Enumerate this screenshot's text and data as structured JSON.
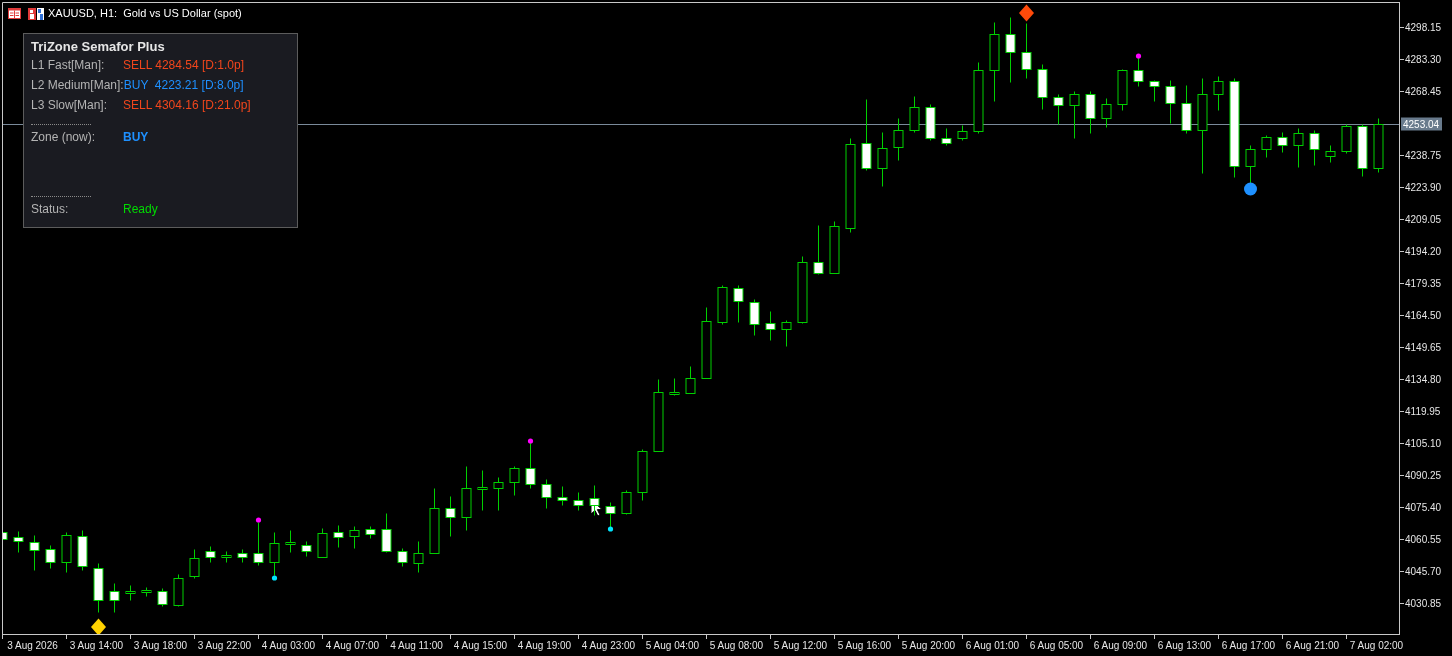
{
  "chart_window": {
    "title": "XAUUSD, H1:  Gold vs US Dollar (spot)"
  },
  "indicator_panel": {
    "title": "TriZone Semafor Plus",
    "levels": [
      {
        "label": "L1 Fast[Man]:",
        "kind": "sell",
        "value": "SELL 4284.54 [D:1.0p]"
      },
      {
        "label": "L2 Medium[Man]:",
        "kind": "buy",
        "value": "BUY  4223.21 [D:8.0p]"
      },
      {
        "label": "L3 Slow[Man]:",
        "kind": "sell",
        "value": "SELL 4304.16 [D:21.0p]"
      }
    ],
    "zone": {
      "label": "Zone (now):",
      "kind": "buy",
      "value": "BUY"
    },
    "status": {
      "label": "Status:",
      "kind": "ready",
      "value": "Ready"
    }
  },
  "chart": {
    "chart_data": {
      "type": "candlestick",
      "categories": [
        null,
        null,
        "3 Aug 2026",
        null,
        null,
        null,
        "3 Aug 14:00",
        null,
        null,
        null,
        "3 Aug 18:00",
        null,
        null,
        null,
        "3 Aug 22:00",
        null,
        null,
        null,
        "4 Aug 03:00",
        null,
        null,
        null,
        "4 Aug 07:00",
        null,
        null,
        null,
        "4 Aug 11:00",
        null,
        null,
        null,
        "4 Aug 15:00",
        null,
        null,
        null,
        "4 Aug 19:00",
        null,
        null,
        null,
        "4 Aug 23:00",
        null,
        null,
        null,
        "5 Aug 04:00",
        null,
        null,
        null,
        "5 Aug 08:00",
        null,
        null,
        null,
        "5 Aug 12:00",
        null,
        null,
        null,
        "5 Aug 16:00",
        null,
        null,
        null,
        "5 Aug 20:00",
        null,
        null,
        null,
        "6 Aug 01:00",
        null,
        null,
        null,
        "6 Aug 05:00",
        null,
        null,
        null,
        "6 Aug 09:00",
        null,
        null,
        null,
        "6 Aug 13:00",
        null,
        null,
        null,
        "6 Aug 17:00",
        null,
        null,
        null,
        "6 Aug 21:00",
        null,
        null,
        null,
        "7 Aug 02:00"
      ],
      "ohlc": [
        [
          4063.8,
          4064.73,
          4059.62,
          4060.55
        ],
        [
          4061.48,
          4064.26,
          4054.52,
          4059.62
        ],
        [
          4059.16,
          4062.41,
          4046.17,
          4055.45
        ],
        [
          4055.91,
          4057.77,
          4047.09,
          4049.88
        ],
        [
          4049.88,
          4063.8,
          4045.24,
          4062.41
        ],
        [
          4061.94,
          4064.73,
          4046.17,
          4048.02
        ],
        [
          4047.09,
          4049.41,
          4026.67,
          4032.24
        ],
        [
          4036.42,
          4040.13,
          4026.67,
          4032.24
        ],
        [
          4035.49,
          4039.2,
          4032.24,
          4036.42
        ],
        [
          4035.96,
          4038.28,
          4034.1,
          4036.88
        ],
        [
          4036.42,
          4037.81,
          4029.46,
          4030.39
        ],
        [
          4029.92,
          4044.31,
          4029.46,
          4042.45
        ],
        [
          4043.38,
          4055.91,
          4042.45,
          4051.73
        ],
        [
          4054.98,
          4057.3,
          4049.88,
          4052.2
        ],
        [
          4052.2,
          4054.98,
          4049.88,
          4053.13
        ],
        [
          4054.05,
          4055.91,
          4049.88,
          4052.2
        ],
        [
          4054.05,
          4068.44,
          4048.49,
          4049.88
        ],
        [
          4049.88,
          4063.8,
          4043.84,
          4058.69
        ],
        [
          4058.23,
          4064.73,
          4054.52,
          4059.16
        ],
        [
          4057.77,
          4059.62,
          4052.66,
          4054.98
        ],
        [
          4052.2,
          4065.66,
          4052.2,
          4063.34
        ],
        [
          4063.8,
          4067.05,
          4056.84,
          4061.48
        ],
        [
          4061.94,
          4066.58,
          4056.37,
          4064.73
        ],
        [
          4065.19,
          4066.58,
          4061.02,
          4062.87
        ],
        [
          4065.19,
          4072.62,
          4054.52,
          4054.98
        ],
        [
          4054.98,
          4056.37,
          4048.02,
          4049.88
        ],
        [
          4049.41,
          4059.62,
          4045.24,
          4054.05
        ],
        [
          4054.05,
          4084.22,
          4054.05,
          4074.94
        ],
        [
          4074.94,
          4080.51,
          4061.94,
          4070.76
        ],
        [
          4070.76,
          4094.43,
          4064.73,
          4084.22
        ],
        [
          4083.75,
          4092.57,
          4074.01,
          4084.68
        ],
        [
          4084.22,
          4089.32,
          4074.01,
          4087.0
        ],
        [
          4087.0,
          4094.43,
          4080.97,
          4093.5
        ],
        [
          4093.5,
          4105.57,
          4084.22,
          4086.07
        ],
        [
          4086.07,
          4088.39,
          4074.94,
          4080.04
        ],
        [
          4080.04,
          4085.15,
          4076.33,
          4078.65
        ],
        [
          4078.65,
          4082.36,
          4074.01,
          4076.33
        ],
        [
          4079.58,
          4085.61,
          4071.69,
          4076.33
        ],
        [
          4075.87,
          4077.72,
          4066.12,
          4072.62
        ],
        [
          4072.62,
          4083.29,
          4072.15,
          4082.36
        ],
        [
          4082.36,
          4102.32,
          4078.65,
          4101.39
        ],
        [
          4101.39,
          4134.8,
          4101.39,
          4128.77
        ],
        [
          4127.84,
          4135.26,
          4127.38,
          4128.77
        ],
        [
          4128.3,
          4140.83,
          4128.3,
          4135.26
        ],
        [
          4135.26,
          4168.21,
          4135.26,
          4161.72
        ],
        [
          4161.25,
          4178.42,
          4160.32,
          4177.49
        ],
        [
          4177.03,
          4178.42,
          4161.25,
          4171.0
        ],
        [
          4170.53,
          4171.92,
          4155.22,
          4160.32
        ],
        [
          4160.79,
          4166.36,
          4152.9,
          4158.0
        ],
        [
          4158.0,
          4162.18,
          4150.11,
          4161.25
        ],
        [
          4161.25,
          4191.88,
          4160.79,
          4189.1
        ],
        [
          4189.1,
          4206.27,
          4183.53,
          4183.99
        ],
        [
          4183.99,
          4208.12,
          4183.99,
          4205.8
        ],
        [
          4204.87,
          4246.64,
          4203.02,
          4243.86
        ],
        [
          4244.32,
          4264.74,
          4231.79,
          4232.72
        ],
        [
          4232.72,
          4249.42,
          4224.36,
          4242.0
        ],
        [
          4242.46,
          4255.92,
          4236.43,
          4250.35
        ],
        [
          4250.35,
          4266.13,
          4249.42,
          4261.03
        ],
        [
          4261.03,
          4262.42,
          4245.71,
          4246.64
        ],
        [
          4246.64,
          4251.28,
          4243.39,
          4244.32
        ],
        [
          4246.64,
          4252.67,
          4245.71,
          4249.89
        ],
        [
          4249.89,
          4281.91,
          4248.96,
          4278.2
        ],
        [
          4278.2,
          4300.47,
          4263.81,
          4294.9
        ],
        [
          4294.9,
          4302.79,
          4272.63,
          4286.55
        ],
        [
          4286.55,
          4300.01,
          4274.48,
          4278.66
        ],
        [
          4278.66,
          4280.98,
          4260.1,
          4265.67
        ],
        [
          4265.67,
          4267.06,
          4253.14,
          4261.95
        ],
        [
          4261.95,
          4268.45,
          4246.64,
          4267.06
        ],
        [
          4267.06,
          4268.45,
          4248.96,
          4255.92
        ],
        [
          4255.92,
          4265.2,
          4251.74,
          4262.42
        ],
        [
          4262.42,
          4278.66,
          4259.63,
          4278.2
        ],
        [
          4278.2,
          4284.23,
          4270.77,
          4273.09
        ],
        [
          4273.09,
          4273.55,
          4263.81,
          4270.77
        ],
        [
          4270.77,
          4273.55,
          4253.6,
          4262.88
        ],
        [
          4262.88,
          4271.23,
          4248.96,
          4250.35
        ],
        [
          4250.35,
          4274.48,
          4230.4,
          4267.06
        ],
        [
          4267.06,
          4275.41,
          4259.63,
          4273.09
        ],
        [
          4273.09,
          4274.48,
          4228.54,
          4233.65
        ],
        [
          4233.65,
          4243.39,
          4225.76,
          4241.54
        ],
        [
          4241.54,
          4248.03,
          4237.82,
          4247.1
        ],
        [
          4247.1,
          4249.42,
          4240.14,
          4243.39
        ],
        [
          4243.39,
          4251.28,
          4233.18,
          4248.96
        ],
        [
          4248.96,
          4250.35,
          4234.11,
          4241.54
        ],
        [
          4238.29,
          4243.39,
          4235.5,
          4240.61
        ],
        [
          4240.61,
          4253.14,
          4239.68,
          4252.21
        ],
        [
          4252.21,
          4253.14,
          4229.0,
          4232.72
        ],
        [
          4232.72,
          4255.92,
          4230.86,
          4253.04
        ]
      ],
      "ylim": [
        4016.01,
        4309.75
      ],
      "yticks": [
        {
          "value": 4298.15,
          "label": "4298.15"
        },
        {
          "value": 4283.3,
          "label": "4283.30"
        },
        {
          "value": 4268.45,
          "label": "4268.45"
        },
        {
          "value": 4238.75,
          "label": "4238.75"
        },
        {
          "value": 4223.9,
          "label": "4223.90"
        },
        {
          "value": 4209.05,
          "label": "4209.05"
        },
        {
          "value": 4194.2,
          "label": "4194.20"
        },
        {
          "value": 4179.35,
          "label": "4179.35"
        },
        {
          "value": 4164.5,
          "label": "4164.50"
        },
        {
          "value": 4149.65,
          "label": "4149.65"
        },
        {
          "value": 4134.8,
          "label": "4134.80"
        },
        {
          "value": 4119.95,
          "label": "4119.95"
        },
        {
          "value": 4105.1,
          "label": "4105.10"
        },
        {
          "value": 4090.25,
          "label": "4090.25"
        },
        {
          "value": 4075.4,
          "label": "4075.40"
        },
        {
          "value": 4060.55,
          "label": "4060.55"
        },
        {
          "value": 4045.7,
          "label": "4045.70"
        },
        {
          "value": 4030.85,
          "label": "4030.85"
        }
      ],
      "ref_lines": [
        {
          "axis": "y",
          "value": 4253.04,
          "label": "4253.04"
        }
      ]
    }
  }
}
